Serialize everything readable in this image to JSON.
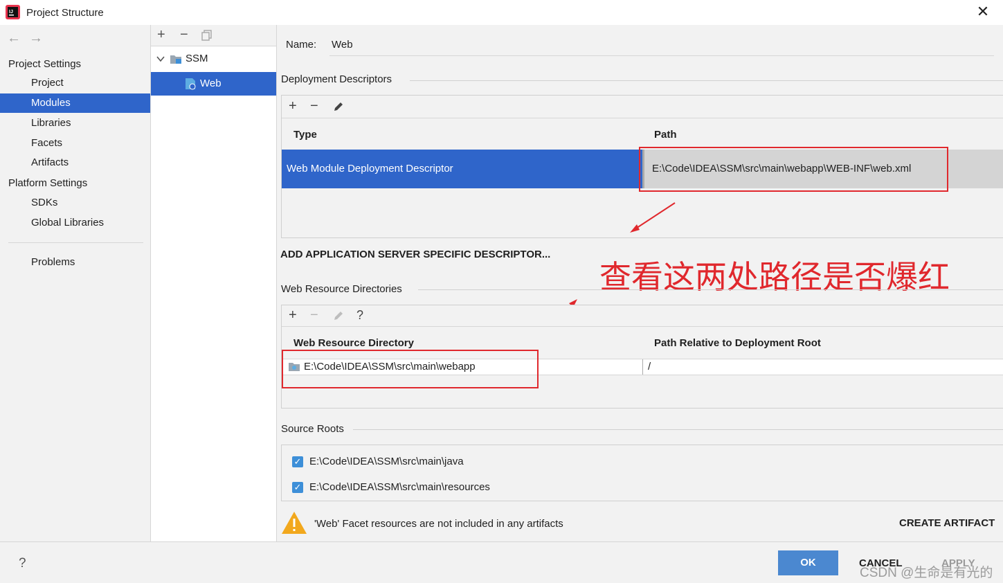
{
  "window": {
    "title": "Project Structure",
    "close_glyph": "✕"
  },
  "nav": {
    "back_glyph": "←",
    "forward_glyph": "→",
    "project_settings_label": "Project Settings",
    "project_items": [
      "Project",
      "Modules",
      "Libraries",
      "Facets",
      "Artifacts"
    ],
    "platform_settings_label": "Platform Settings",
    "platform_items": [
      "SDKs",
      "Global Libraries"
    ],
    "problems_label": "Problems",
    "selected": "Modules"
  },
  "tree": {
    "toolbar": {
      "add": "+",
      "remove": "−",
      "copy_icon": "copy-icon"
    },
    "nodes": [
      {
        "label": "SSM",
        "expanded": true,
        "icon": "module-folder-icon"
      },
      {
        "label": "Web",
        "selected": true,
        "icon": "web-facet-icon"
      }
    ]
  },
  "facet": {
    "name_label": "Name:",
    "name_value": "Web",
    "deployment": {
      "section_label": "Deployment Descriptors",
      "col_type": "Type",
      "col_path": "Path",
      "rows": [
        {
          "type": "Web Module Deployment Descriptor",
          "path": "E:\\Code\\IDEA\\SSM\\src\\main\\webapp\\WEB-INF\\web.xml"
        }
      ],
      "add_server_descriptor": "ADD APPLICATION SERVER SPECIFIC DESCRIPTOR..."
    },
    "annotation": "查看这两处路径是否爆红",
    "web_resources": {
      "section_label": "Web Resource Directories",
      "help_glyph": "?",
      "col_dir": "Web Resource Directory",
      "col_rel": "Path Relative to Deployment Root",
      "rows": [
        {
          "dir": "E:\\Code\\IDEA\\SSM\\src\\main\\webapp",
          "relative": "/"
        }
      ]
    },
    "source_roots": {
      "section_label": "Source Roots",
      "items": [
        {
          "path": "E:\\Code\\IDEA\\SSM\\src\\main\\java",
          "checked": true
        },
        {
          "path": "E:\\Code\\IDEA\\SSM\\src\\main\\resources",
          "checked": true
        }
      ]
    },
    "warning": {
      "text": "'Web' Facet resources are not included in any artifacts",
      "action": "CREATE ARTIFACT"
    }
  },
  "footer": {
    "help": "?",
    "ok": "OK",
    "cancel": "CANCEL",
    "apply": "APPLY",
    "watermark": "CSDN @生命是有光的"
  },
  "colors": {
    "selection": "#2f65ca",
    "ok_button": "#4b88d0",
    "highlight_box": "#e0282d",
    "warning": "#f2a81d"
  }
}
